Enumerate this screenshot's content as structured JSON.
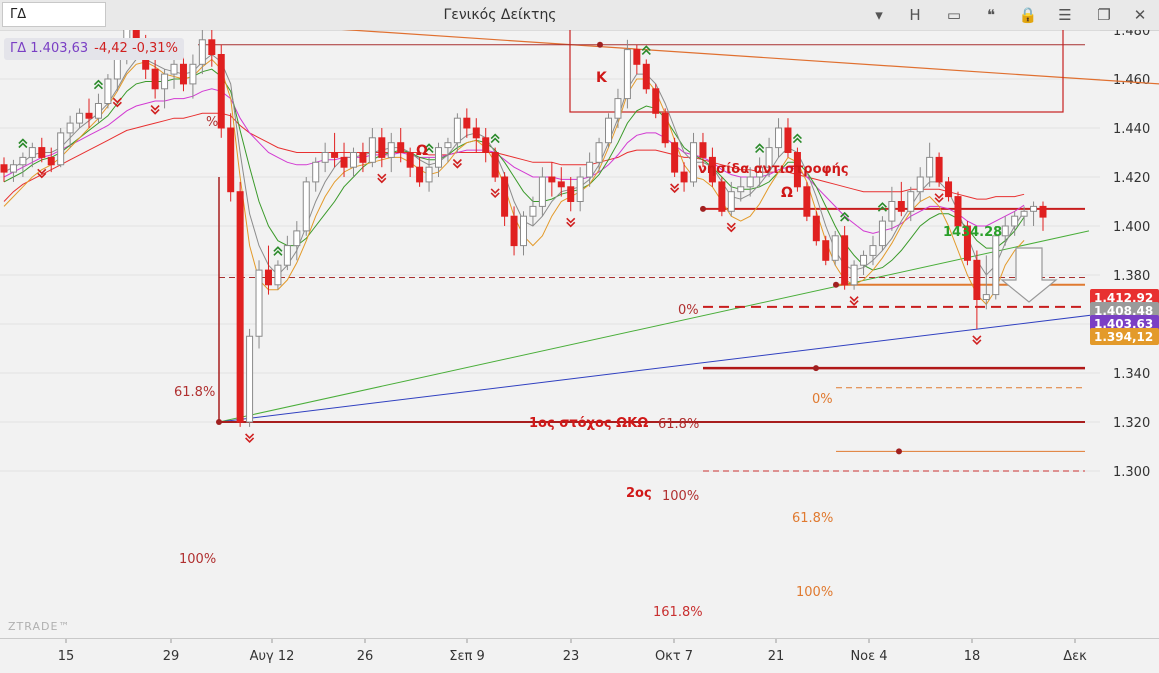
{
  "window": {
    "symbol": "ΓΔ",
    "title": "Γενικός Δείκτης",
    "buttons": [
      "▾",
      "H",
      "▭",
      "❝",
      "🔒",
      "☰",
      "❐",
      "✕"
    ]
  },
  "quote": {
    "name": "ΓΔ 1.403,63",
    "change": "-4,42 -0,31%"
  },
  "watermark": "ZTRADE™",
  "colors": {
    "up": "#9a9a9a",
    "down": "#e02020",
    "ma_gray": "#8c8c8c",
    "ma_green": "#3a9a2a",
    "ma_magenta": "#d23ad2",
    "ma_red": "#e83030",
    "ma_orange": "#e39a2a",
    "fib_red": "#c81e1e",
    "fib_orange": "#e07a30"
  },
  "chart_data": {
    "type": "candlestick",
    "x_tick_labels": [
      "15",
      "29",
      "Αυγ 12",
      "26",
      "Σεπ 9",
      "23",
      "Οκτ 7",
      "21",
      "Νοε 4",
      "18",
      "Δεκ"
    ],
    "y_tick_labels": [
      "1.300",
      "1.320",
      "1.340",
      "1.360",
      "1.380",
      "1.400",
      "1.420",
      "1.440",
      "1.460",
      "1.480"
    ],
    "ylim": [
      1296,
      1500
    ],
    "candles": [
      [
        1425,
        1428,
        1418,
        1422
      ],
      [
        1422,
        1427,
        1418,
        1425
      ],
      [
        1425,
        1430,
        1420,
        1428
      ],
      [
        1428,
        1434,
        1424,
        1432
      ],
      [
        1432,
        1436,
        1426,
        1428
      ],
      [
        1428,
        1432,
        1422,
        1425
      ],
      [
        1425,
        1440,
        1424,
        1438
      ],
      [
        1438,
        1445,
        1432,
        1442
      ],
      [
        1442,
        1448,
        1440,
        1446
      ],
      [
        1446,
        1452,
        1440,
        1444
      ],
      [
        1444,
        1454,
        1442,
        1450
      ],
      [
        1450,
        1462,
        1448,
        1460
      ],
      [
        1460,
        1472,
        1455,
        1468
      ],
      [
        1468,
        1486,
        1466,
        1484
      ],
      [
        1484,
        1488,
        1470,
        1474
      ],
      [
        1474,
        1478,
        1460,
        1464
      ],
      [
        1464,
        1470,
        1452,
        1456
      ],
      [
        1456,
        1464,
        1448,
        1462
      ],
      [
        1462,
        1470,
        1456,
        1466
      ],
      [
        1466,
        1470,
        1455,
        1458
      ],
      [
        1458,
        1470,
        1452,
        1466
      ],
      [
        1466,
        1480,
        1462,
        1476
      ],
      [
        1476,
        1480,
        1465,
        1470
      ],
      [
        1470,
        1474,
        1436,
        1440
      ],
      [
        1440,
        1446,
        1410,
        1414
      ],
      [
        1414,
        1418,
        1318,
        1320
      ],
      [
        1320,
        1358,
        1318,
        1355
      ],
      [
        1355,
        1386,
        1350,
        1382
      ],
      [
        1382,
        1392,
        1372,
        1376
      ],
      [
        1376,
        1386,
        1374,
        1384
      ],
      [
        1384,
        1396,
        1382,
        1392
      ],
      [
        1392,
        1402,
        1386,
        1398
      ],
      [
        1398,
        1420,
        1396,
        1418
      ],
      [
        1418,
        1428,
        1414,
        1426
      ],
      [
        1426,
        1434,
        1422,
        1430
      ],
      [
        1430,
        1438,
        1424,
        1428
      ],
      [
        1428,
        1434,
        1420,
        1424
      ],
      [
        1424,
        1432,
        1420,
        1430
      ],
      [
        1430,
        1434,
        1422,
        1426
      ],
      [
        1426,
        1440,
        1424,
        1436
      ],
      [
        1436,
        1440,
        1424,
        1428
      ],
      [
        1428,
        1438,
        1422,
        1434
      ],
      [
        1434,
        1440,
        1426,
        1430
      ],
      [
        1430,
        1432,
        1420,
        1424
      ],
      [
        1424,
        1428,
        1416,
        1418
      ],
      [
        1418,
        1428,
        1414,
        1424
      ],
      [
        1424,
        1434,
        1420,
        1432
      ],
      [
        1432,
        1436,
        1426,
        1434
      ],
      [
        1434,
        1446,
        1430,
        1444
      ],
      [
        1444,
        1448,
        1436,
        1440
      ],
      [
        1440,
        1444,
        1430,
        1436
      ],
      [
        1436,
        1440,
        1426,
        1430
      ],
      [
        1430,
        1432,
        1418,
        1420
      ],
      [
        1420,
        1422,
        1400,
        1404
      ],
      [
        1404,
        1408,
        1388,
        1392
      ],
      [
        1392,
        1406,
        1388,
        1404
      ],
      [
        1404,
        1412,
        1400,
        1408
      ],
      [
        1408,
        1424,
        1404,
        1420
      ],
      [
        1420,
        1426,
        1412,
        1418
      ],
      [
        1418,
        1424,
        1412,
        1416
      ],
      [
        1416,
        1420,
        1406,
        1410
      ],
      [
        1410,
        1424,
        1406,
        1420
      ],
      [
        1420,
        1430,
        1416,
        1426
      ],
      [
        1426,
        1436,
        1422,
        1434
      ],
      [
        1434,
        1446,
        1432,
        1444
      ],
      [
        1444,
        1456,
        1440,
        1452
      ],
      [
        1452,
        1476,
        1448,
        1472
      ],
      [
        1472,
        1474,
        1462,
        1466
      ],
      [
        1466,
        1468,
        1454,
        1456
      ],
      [
        1456,
        1458,
        1444,
        1446
      ],
      [
        1446,
        1448,
        1432,
        1434
      ],
      [
        1434,
        1436,
        1420,
        1422
      ],
      [
        1422,
        1426,
        1414,
        1418
      ],
      [
        1418,
        1438,
        1416,
        1434
      ],
      [
        1434,
        1438,
        1424,
        1428
      ],
      [
        1428,
        1432,
        1416,
        1418
      ],
      [
        1418,
        1420,
        1404,
        1406
      ],
      [
        1406,
        1418,
        1404,
        1414
      ],
      [
        1414,
        1420,
        1410,
        1416
      ],
      [
        1416,
        1424,
        1412,
        1420
      ],
      [
        1420,
        1428,
        1416,
        1424
      ],
      [
        1424,
        1436,
        1420,
        1432
      ],
      [
        1432,
        1444,
        1428,
        1440
      ],
      [
        1440,
        1444,
        1428,
        1430
      ],
      [
        1430,
        1432,
        1414,
        1416
      ],
      [
        1416,
        1418,
        1402,
        1404
      ],
      [
        1404,
        1406,
        1392,
        1394
      ],
      [
        1394,
        1396,
        1384,
        1386
      ],
      [
        1386,
        1398,
        1384,
        1396
      ],
      [
        1396,
        1400,
        1374,
        1376
      ],
      [
        1376,
        1386,
        1374,
        1384
      ],
      [
        1384,
        1390,
        1380,
        1388
      ],
      [
        1388,
        1396,
        1384,
        1392
      ],
      [
        1392,
        1404,
        1390,
        1402
      ],
      [
        1402,
        1416,
        1398,
        1410
      ],
      [
        1410,
        1418,
        1404,
        1406
      ],
      [
        1406,
        1416,
        1402,
        1414
      ],
      [
        1414,
        1424,
        1410,
        1420
      ],
      [
        1420,
        1434,
        1416,
        1428
      ],
      [
        1428,
        1430,
        1416,
        1418
      ],
      [
        1418,
        1420,
        1410,
        1412
      ],
      [
        1412,
        1414,
        1398,
        1400
      ],
      [
        1400,
        1402,
        1384,
        1386
      ],
      [
        1386,
        1390,
        1358,
        1370
      ],
      [
        1370,
        1388,
        1366,
        1372
      ],
      [
        1372,
        1400,
        1370,
        1396
      ],
      [
        1396,
        1404,
        1392,
        1400
      ],
      [
        1400,
        1406,
        1396,
        1404
      ],
      [
        1404,
        1408,
        1400,
        1406
      ],
      [
        1406,
        1410,
        1400,
        1408
      ],
      [
        1408,
        1410,
        1398,
        1403.63
      ]
    ],
    "moving_averages": [
      {
        "color_key": "ma_red",
        "values": [
          1410,
          1414,
          1417,
          1419,
          1421,
          1423,
          1425,
          1427,
          1429,
          1431,
          1433,
          1435,
          1437,
          1439,
          1440,
          1441,
          1442,
          1443,
          1444,
          1444,
          1445,
          1446,
          1446,
          1446,
          1445,
          1441,
          1438,
          1436,
          1434,
          1432,
          1431,
          1430,
          1430,
          1430,
          1430,
          1430,
          1430,
          1430,
          1430,
          1430,
          1430,
          1430,
          1430,
          1430,
          1430,
          1429,
          1429,
          1429,
          1430,
          1430,
          1430,
          1430,
          1430,
          1429,
          1428,
          1427,
          1426,
          1426,
          1426,
          1425,
          1425,
          1425,
          1425,
          1426,
          1427,
          1428,
          1430,
          1431,
          1431,
          1431,
          1430,
          1429,
          1428,
          1428,
          1427,
          1426,
          1425,
          1424,
          1423,
          1423,
          1422,
          1422,
          1422,
          1422,
          1421,
          1420,
          1419,
          1418,
          1417,
          1416,
          1415,
          1414,
          1414,
          1414,
          1414,
          1414,
          1415,
          1415,
          1415,
          1415,
          1414,
          1413,
          1412,
          1411,
          1411,
          1412,
          1412,
          1412,
          1412.92
        ]
      },
      {
        "color_key": "ma_magenta",
        "values": [
          1420,
          1422,
          1424,
          1426,
          1428,
          1429,
          1431,
          1433,
          1435,
          1437,
          1439,
          1441,
          1444,
          1447,
          1449,
          1450,
          1451,
          1451,
          1452,
          1452,
          1453,
          1455,
          1456,
          1455,
          1452,
          1444,
          1438,
          1434,
          1430,
          1428,
          1426,
          1425,
          1425,
          1426,
          1427,
          1427,
          1428,
          1428,
          1428,
          1429,
          1429,
          1429,
          1430,
          1429,
          1428,
          1428,
          1428,
          1429,
          1430,
          1431,
          1431,
          1431,
          1430,
          1427,
          1424,
          1422,
          1420,
          1420,
          1420,
          1419,
          1419,
          1419,
          1420,
          1422,
          1425,
          1429,
          1434,
          1437,
          1438,
          1438,
          1436,
          1433,
          1430,
          1429,
          1428,
          1426,
          1423,
          1421,
          1420,
          1420,
          1420,
          1421,
          1423,
          1424,
          1423,
          1420,
          1416,
          1412,
          1408,
          1404,
          1401,
          1398,
          1397,
          1398,
          1399,
          1401,
          1404,
          1406,
          1408,
          1408,
          1407,
          1405,
          1402,
          1400,
          1400,
          1402,
          1404,
          1406,
          1408.48
        ]
      },
      {
        "color_key": "ma_green",
        "values": [
          1418,
          1420,
          1422,
          1425,
          1427,
          1428,
          1430,
          1433,
          1436,
          1439,
          1442,
          1445,
          1450,
          1455,
          1458,
          1459,
          1459,
          1459,
          1460,
          1460,
          1461,
          1463,
          1464,
          1461,
          1455,
          1439,
          1424,
          1410,
          1400,
          1394,
          1392,
          1392,
          1395,
          1400,
          1405,
          1410,
          1416,
          1420,
          1424,
          1427,
          1429,
          1430,
          1431,
          1430,
          1428,
          1427,
          1427,
          1429,
          1432,
          1434,
          1435,
          1434,
          1431,
          1426,
          1420,
          1414,
          1410,
          1410,
          1411,
          1413,
          1414,
          1415,
          1417,
          1421,
          1427,
          1434,
          1442,
          1447,
          1449,
          1448,
          1444,
          1438,
          1432,
          1429,
          1427,
          1424,
          1420,
          1416,
          1415,
          1415,
          1416,
          1418,
          1422,
          1426,
          1426,
          1422,
          1416,
          1408,
          1400,
          1393,
          1388,
          1384,
          1382,
          1383,
          1386,
          1390,
          1395,
          1400,
          1403,
          1405,
          1405,
          1403,
          1399,
          1394,
          1391,
          1391,
          1394,
          1398,
          1403.63
        ]
      },
      {
        "color_key": "ma_gray",
        "values": [
          1422,
          1424,
          1426,
          1429,
          1430,
          1430,
          1432,
          1436,
          1440,
          1443,
          1446,
          1450,
          1456,
          1463,
          1468,
          1468,
          1466,
          1464,
          1463,
          1462,
          1463,
          1467,
          1470,
          1467,
          1458,
          1430,
          1405,
          1392,
          1384,
          1380,
          1384,
          1390,
          1400,
          1410,
          1418,
          1424,
          1428,
          1428,
          1429,
          1430,
          1431,
          1432,
          1432,
          1430,
          1427,
          1425,
          1426,
          1429,
          1434,
          1437,
          1438,
          1436,
          1430,
          1421,
          1410,
          1402,
          1400,
          1404,
          1410,
          1414,
          1415,
          1416,
          1419,
          1425,
          1434,
          1444,
          1456,
          1462,
          1462,
          1458,
          1450,
          1440,
          1430,
          1426,
          1426,
          1424,
          1418,
          1412,
          1411,
          1413,
          1417,
          1422,
          1428,
          1432,
          1430,
          1422,
          1412,
          1400,
          1390,
          1384,
          1382,
          1383,
          1386,
          1390,
          1395,
          1402,
          1408,
          1414,
          1418,
          1418,
          1414,
          1406,
          1396,
          1386,
          1380,
          1384,
          1393,
          1400,
          1406
        ]
      },
      {
        "color_key": "ma_orange",
        "values": [
          1408,
          1412,
          1416,
          1420,
          1423,
          1425,
          1428,
          1432,
          1436,
          1440,
          1444,
          1449,
          1455,
          1462,
          1466,
          1467,
          1465,
          1462,
          1461,
          1460,
          1461,
          1465,
          1468,
          1464,
          1452,
          1420,
          1392,
          1378,
          1374,
          1374,
          1378,
          1385,
          1394,
          1404,
          1412,
          1418,
          1422,
          1424,
          1425,
          1426,
          1427,
          1428,
          1428,
          1426,
          1423,
          1421,
          1422,
          1426,
          1431,
          1434,
          1435,
          1432,
          1426,
          1416,
          1404,
          1396,
          1392,
          1396,
          1404,
          1410,
          1412,
          1414,
          1417,
          1423,
          1432,
          1442,
          1454,
          1460,
          1460,
          1455,
          1446,
          1435,
          1425,
          1420,
          1419,
          1416,
          1410,
          1404,
          1402,
          1404,
          1409,
          1416,
          1422,
          1428,
          1426,
          1418,
          1406,
          1394,
          1384,
          1378,
          1376,
          1378,
          1382,
          1387,
          1393,
          1400,
          1406,
          1410,
          1412,
          1408,
          1400,
          1390,
          1380,
          1372,
          1368,
          1374,
          1384,
          1390,
          1394.12
        ]
      }
    ],
    "price_labels": [
      {
        "text": "1.412,92",
        "value": 1412.92,
        "bg": "#e83030"
      },
      {
        "text": "1.408,48",
        "value": 1408.48,
        "bg": "#9a9a9a"
      },
      {
        "text": "1.403,63",
        "value": 1403.63,
        "bg": "#7a3fc4"
      },
      {
        "text": "1.394,12",
        "value": 1394.12,
        "bg": "#e39a2a"
      }
    ],
    "annotations": {
      "K": "K",
      "omega1": "Ω",
      "omega2": "Ω",
      "island": "νησίδα αντιστροφής",
      "target1": "1ος στόχος ΩΚΩ",
      "target2": "2ος",
      "peak_value": "1434.28",
      "fib_0_top": "%",
      "fib_0_mid": "0%",
      "fib_0_low": "0%",
      "fib_618_left": "61.8%",
      "fib_618_mid": "61.8%",
      "fib_100_mid": "100%",
      "fib_100_left": "100%",
      "fib_618_orange": "61.8%",
      "fib_100_orange": "100%",
      "fib_1618_orange": "161.8%"
    }
  }
}
